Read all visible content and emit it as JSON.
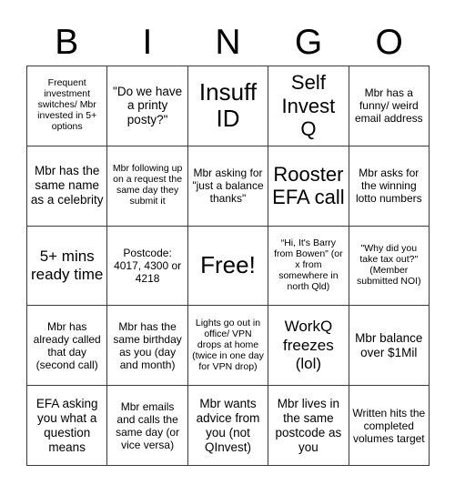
{
  "card": {
    "title": "BINGO",
    "header_letters": [
      "B",
      "I",
      "N",
      "G",
      "O"
    ],
    "grid_size": "5x5",
    "free_space_index": 12,
    "colors": {
      "text": "#000000",
      "grid_line": "#3a3a3a",
      "background": "#ffffff"
    },
    "cells": [
      {
        "text": "Frequent investment switches/ Mbr invested in 5+ options",
        "size": "xs",
        "free": false
      },
      {
        "text": "\"Do we have a printy posty?\"",
        "size": "m",
        "free": false
      },
      {
        "text": "Insuff ID",
        "size": "xxl",
        "free": false
      },
      {
        "text": "Self Invest Q",
        "size": "xl",
        "free": false
      },
      {
        "text": "Mbr has a funny/ weird email address",
        "size": "s",
        "free": false
      },
      {
        "text": "Mbr has the same name as a celebrity",
        "size": "m",
        "free": false
      },
      {
        "text": "Mbr following up on a request the same day they submit it",
        "size": "xs",
        "free": false
      },
      {
        "text": "Mbr asking for \"just a balance thanks\"",
        "size": "s",
        "free": false
      },
      {
        "text": "Rooster EFA call",
        "size": "xl",
        "free": false
      },
      {
        "text": "Mbr asks for the winning lotto numbers",
        "size": "s",
        "free": false
      },
      {
        "text": "5+ mins ready time",
        "size": "l",
        "free": false
      },
      {
        "text": "Postcode: 4017, 4300 or 4218",
        "size": "s",
        "free": false
      },
      {
        "text": "Free!",
        "size": "xxl",
        "free": true
      },
      {
        "text": "“Hi, It's Barry from Bowen\" (or x from somewhere in north Qld)",
        "size": "xs",
        "free": false
      },
      {
        "text": "\"Why did you take tax out?\" (Member submitted NOI)",
        "size": "xs",
        "free": false
      },
      {
        "text": "Mbr has already called that day (second call)",
        "size": "s",
        "free": false
      },
      {
        "text": "Mbr has the same birthday as you (day and month)",
        "size": "s",
        "free": false
      },
      {
        "text": "Lights go out in office/ VPN drops at home (twice in one day for VPN drop)",
        "size": "xs",
        "free": false
      },
      {
        "text": "WorkQ freezes (lol)",
        "size": "l",
        "free": false
      },
      {
        "text": "Mbr balance over $1Mil",
        "size": "m",
        "free": false
      },
      {
        "text": "EFA asking you what a question means",
        "size": "m",
        "free": false
      },
      {
        "text": "Mbr emails and calls the same day (or vice versa)",
        "size": "s",
        "free": false
      },
      {
        "text": "Mbr wants advice from you (not QInvest)",
        "size": "m",
        "free": false
      },
      {
        "text": "Mbr lives in the same postcode as you",
        "size": "m",
        "free": false
      },
      {
        "text": "Written hits the completed volumes target",
        "size": "s",
        "free": false
      }
    ]
  }
}
